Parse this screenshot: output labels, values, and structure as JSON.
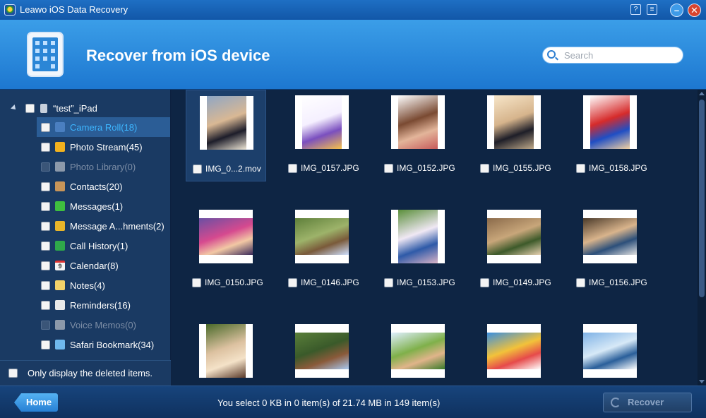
{
  "window": {
    "title": "Leawo iOS Data Recovery",
    "help_label": "?",
    "menu_label": "≡",
    "minimize_label": "–",
    "close_label": "✕"
  },
  "header": {
    "title": "Recover from iOS device",
    "search_placeholder": "Search"
  },
  "sidebar": {
    "device_name": "“test”_iPad",
    "items": [
      {
        "label": "Camera Roll(18)",
        "icon": "camera-roll-icon",
        "color": "#4a7fc0",
        "state": "selected"
      },
      {
        "label": "Photo Stream(45)",
        "icon": "photo-stream-icon",
        "color": "#f2b21f",
        "state": "normal"
      },
      {
        "label": "Photo Library(0)",
        "icon": "photo-library-icon",
        "color": "#8c99aa",
        "state": "disabled"
      },
      {
        "label": "Contacts(20)",
        "icon": "contacts-icon",
        "color": "#c89559",
        "state": "normal"
      },
      {
        "label": "Messages(1)",
        "icon": "messages-icon",
        "color": "#3fbf3f",
        "state": "normal"
      },
      {
        "label": "Message A...hments(2)",
        "icon": "message-attachments-icon",
        "color": "#e8b52a",
        "state": "normal"
      },
      {
        "label": "Call History(1)",
        "icon": "call-history-icon",
        "color": "#2fa84a",
        "state": "normal"
      },
      {
        "label": "Calendar(8)",
        "icon": "calendar-icon",
        "color": "#f5f5f5",
        "state": "normal"
      },
      {
        "label": "Notes(4)",
        "icon": "notes-icon",
        "color": "#f3d36a",
        "state": "normal"
      },
      {
        "label": "Reminders(16)",
        "icon": "reminders-icon",
        "color": "#e9e9e9",
        "state": "normal"
      },
      {
        "label": "Voice Memos(0)",
        "icon": "voice-memos-icon",
        "color": "#8c99aa",
        "state": "disabled"
      },
      {
        "label": "Safari Bookmark(34)",
        "icon": "safari-bookmark-icon",
        "color": "#6fb8ee",
        "state": "normal"
      }
    ],
    "calendar_day": "9",
    "only_deleted_label": "Only display the deleted items."
  },
  "grid": {
    "items": [
      {
        "name": "IMG_0...2.mov",
        "selected": true
      },
      {
        "name": "IMG_0157.JPG"
      },
      {
        "name": "IMG_0152.JPG"
      },
      {
        "name": "IMG_0155.JPG"
      },
      {
        "name": "IMG_0158.JPG"
      },
      {
        "name": "IMG_0150.JPG"
      },
      {
        "name": "IMG_0146.JPG"
      },
      {
        "name": "IMG_0153.JPG"
      },
      {
        "name": "IMG_0149.JPG"
      },
      {
        "name": "IMG_0156.JPG"
      },
      {
        "name": ""
      },
      {
        "name": ""
      },
      {
        "name": ""
      },
      {
        "name": ""
      },
      {
        "name": ""
      }
    ]
  },
  "footer": {
    "home_label": "Home",
    "status_text": "You select 0 KB in 0 item(s) of 21.74 MB in 149 item(s)",
    "recover_label": "Recover"
  }
}
